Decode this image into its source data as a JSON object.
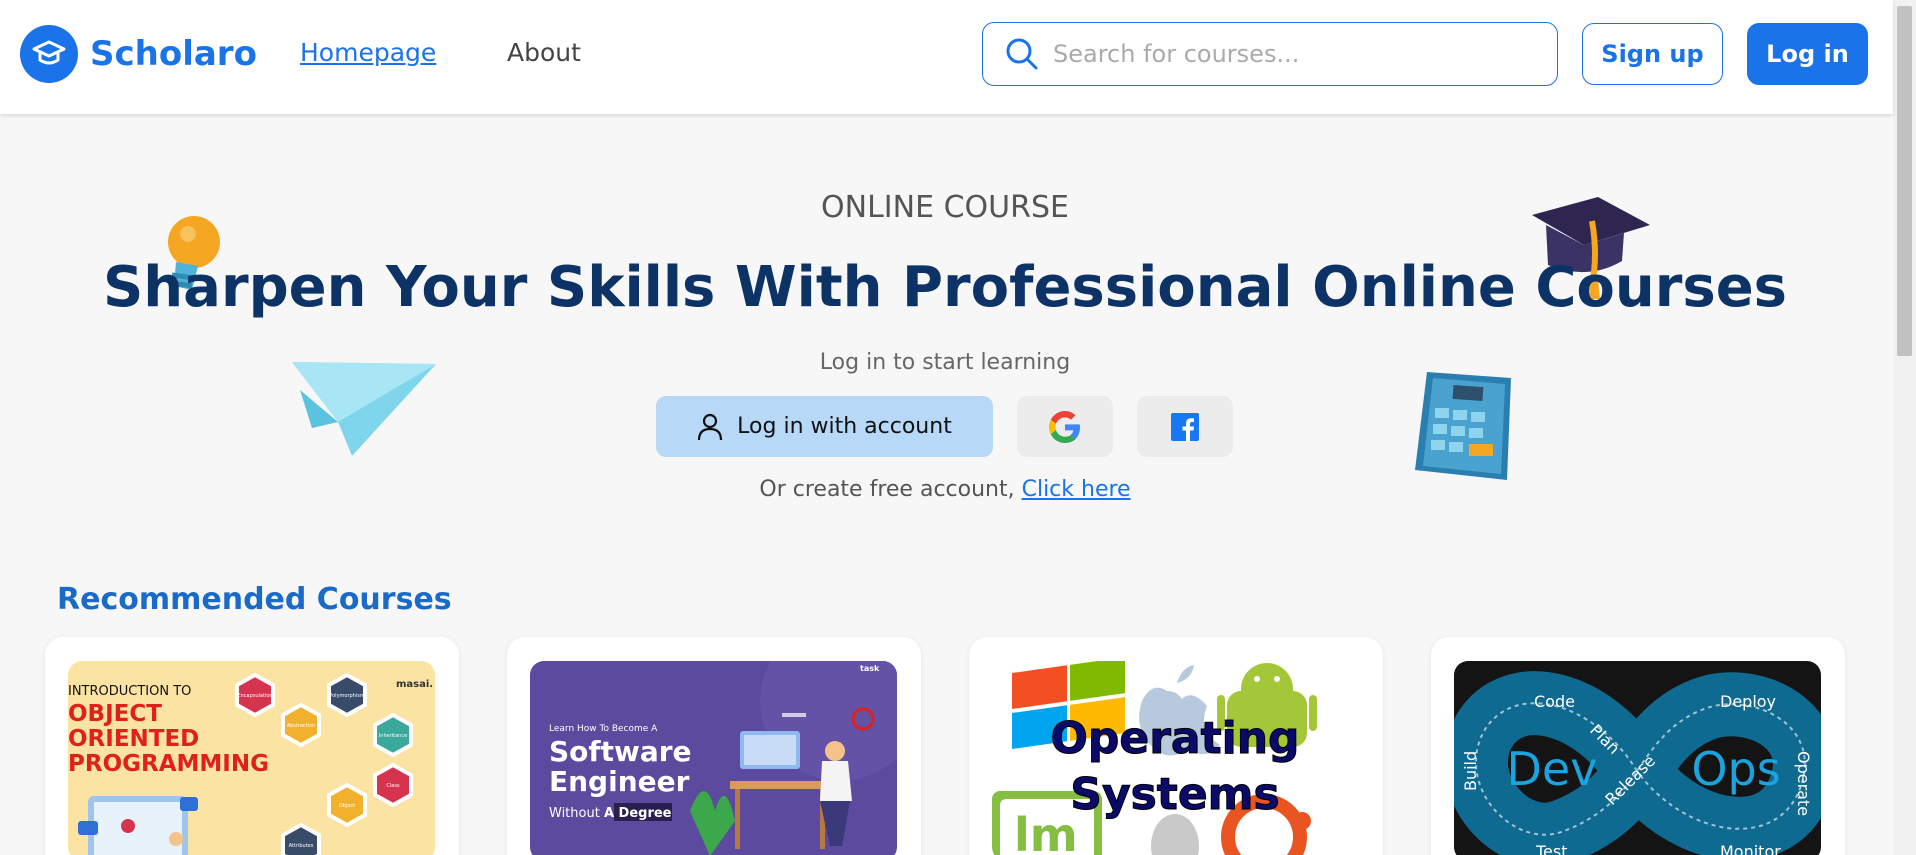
{
  "header": {
    "brand": "Scholaro",
    "nav": {
      "home": "Homepage",
      "about": "About"
    },
    "search": {
      "placeholder": "Search for courses..."
    },
    "signup_label": "Sign up",
    "login_label": "Log in"
  },
  "hero": {
    "eyebrow": "ONLINE COURSE",
    "title": "Sharpen Your Skills With Professional Online Courses",
    "subtitle": "Log in to start learning",
    "account_button": "Log in with account",
    "create_prefix": "Or create free account, ",
    "create_link": "Click here"
  },
  "courses": {
    "heading": "Recommended Courses",
    "items": [
      {
        "kicker": "INTRODUCTION TO",
        "title_lines": [
          "OBJECT",
          "ORIENTED",
          "PROGRAMMING"
        ],
        "brand": "masai.",
        "hexes": [
          "Encapsulation",
          "Polymorphism",
          "Abstraction",
          "Inheritance",
          "Class",
          "Object",
          "Attributes"
        ]
      },
      {
        "kicker": "Learn How To Become A",
        "title_lines": [
          "Software",
          "Engineer"
        ],
        "tagline_prefix": "Without ",
        "tagline_highlight": "A Degree",
        "brand": "task"
      },
      {
        "title_lines": [
          "Operating",
          "Systems"
        ]
      },
      {
        "left": "Dev",
        "right": "Ops",
        "labels": [
          "Code",
          "Plan",
          "Build",
          "Test",
          "Release",
          "Deploy",
          "Operate",
          "Monitor"
        ]
      }
    ]
  },
  "colors": {
    "primary": "#1a73e8",
    "title": "#0d3366",
    "account_button": "#b7d9f7",
    "section": "#1a6bc9"
  }
}
